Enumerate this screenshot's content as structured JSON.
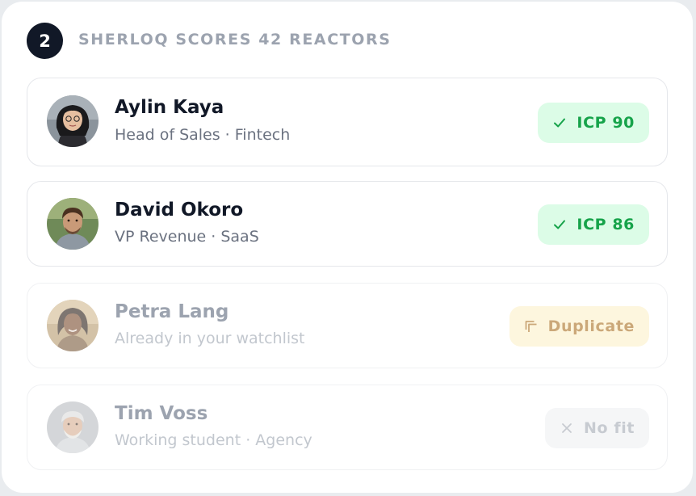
{
  "step": {
    "number": "2",
    "title": "SHERLOQ SCORES 42 REACTORS"
  },
  "reactors": [
    {
      "name": "Aylin Kaya",
      "subtitle": "Head of Sales · Fintech",
      "badge": {
        "label": "ICP 90",
        "icon": "check-icon",
        "status": "match",
        "color": "#16a34a"
      }
    },
    {
      "name": "David Okoro",
      "subtitle": "VP Revenue · SaaS",
      "badge": {
        "label": "ICP 86",
        "icon": "check-icon",
        "status": "match",
        "color": "#16a34a"
      }
    },
    {
      "name": "Petra Lang",
      "subtitle": "Already in your watchlist",
      "badge": {
        "label": "Duplicate",
        "icon": "duplicate-icon",
        "status": "duplicate",
        "color": "#cba879"
      }
    },
    {
      "name": "Tim Voss",
      "subtitle": "Working student · Agency",
      "badge": {
        "label": "No fit",
        "icon": "close-icon",
        "status": "no-fit",
        "color": "#c7cbd1"
      }
    }
  ]
}
